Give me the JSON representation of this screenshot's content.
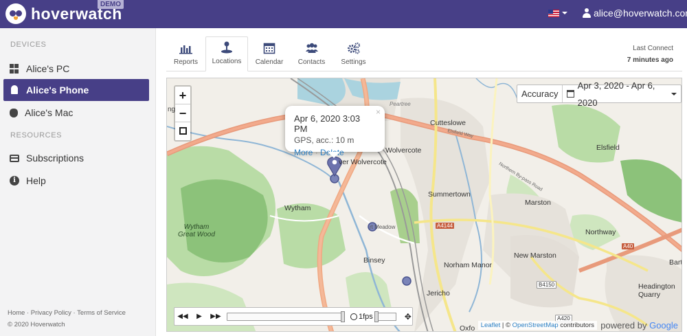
{
  "brand": {
    "name": "hoverwatch",
    "badge": "DEMO"
  },
  "header": {
    "user_email": "alice@hoverwatch.com",
    "flag_icon": "us-flag-icon"
  },
  "sidebar": {
    "devices_title": "DEVICES",
    "devices": [
      {
        "label": "Alice's PC",
        "icon": "windows-icon"
      },
      {
        "label": "Alice's Phone",
        "icon": "android-icon",
        "active": true
      },
      {
        "label": "Alice's Mac",
        "icon": "apple-icon"
      }
    ],
    "resources_title": "RESOURCES",
    "resources": [
      {
        "label": "Subscriptions",
        "icon": "subscriptions-icon"
      },
      {
        "label": "Help",
        "icon": "info-icon"
      }
    ],
    "footer_links": "Home · Privacy Policy · Terms of Service",
    "copyright": "© 2020 Hoverwatch"
  },
  "tabs": [
    {
      "label": "Reports",
      "icon": "bar-chart-icon"
    },
    {
      "label": "Locations",
      "icon": "location-icon",
      "active": true
    },
    {
      "label": "Calendar",
      "icon": "calendar-icon"
    },
    {
      "label": "Contacts",
      "icon": "contacts-icon"
    },
    {
      "label": "Settings",
      "icon": "gears-icon"
    }
  ],
  "last_connect": {
    "label": "Last Connect",
    "value": "7 minutes ago"
  },
  "map": {
    "zoom_in": "+",
    "zoom_out": "−",
    "accuracy_label": "Accuracy",
    "date_range": "Apr 3, 2020 - Apr 6, 2020",
    "popup": {
      "title": "Apr 6, 2020 3:03 PM",
      "accuracy": "GPS, acc.: 10 m",
      "more": "More",
      "sep": "·",
      "delete": "Delete",
      "close": "×"
    },
    "player": {
      "fps": "1fps"
    },
    "attribution": {
      "leaflet": "Leaflet",
      "osm": "OpenStreetMap",
      "suffix": "contributors",
      "powered": "powered by",
      "google": "Google"
    },
    "labels": {
      "cutteslowe": "Cutteslowe",
      "wolvercote": "Wolvercote",
      "lower_wolvercote": "ver Wolvercote",
      "elsfield": "Elsfield",
      "summertown": "Summertown",
      "marston": "Marston",
      "northway": "Northway",
      "wytham": "Wytham",
      "wytham_wood": "Wytham\nGreat Wood",
      "binsey": "Binsey",
      "norham_manor": "Norham Manor",
      "new_marston": "New Marston",
      "headington_quarry": "Headington\nQuarry",
      "jericho": "Jericho",
      "oxfo": "Oxfo",
      "barton": "Bart",
      "peartree": "Peartree",
      "port_meadow": "rt Meadow",
      "ington": "ngton",
      "a4144": "A4144",
      "a40": "A40",
      "b4150": "B4150",
      "a420": "A420",
      "elsfield_way": "Elsfield Way",
      "northern_bypass": "Northern By-pass Road"
    }
  }
}
